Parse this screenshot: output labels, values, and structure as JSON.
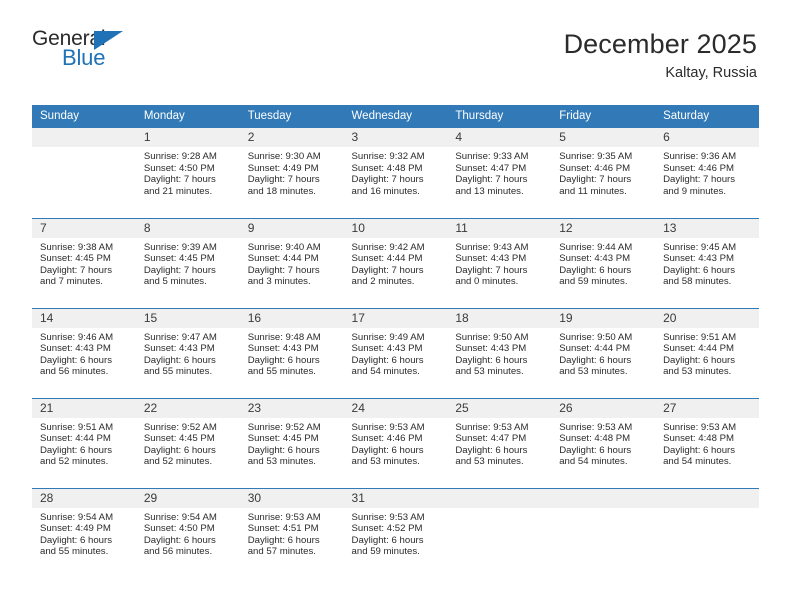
{
  "brand": {
    "name_part1": "General",
    "name_part2": "Blue",
    "accent_color": "#1f72b5",
    "triangle_icon": "triangle-icon"
  },
  "header": {
    "title": "December 2025",
    "subtitle": "Kaltay, Russia"
  },
  "theme": {
    "header_row_bg": "#3179b7",
    "header_row_text": "#ffffff",
    "daynum_bg": "#f0f0f0",
    "body_text": "#2b2b2b",
    "grid_line": "#3179b7"
  },
  "columns": [
    "Sunday",
    "Monday",
    "Tuesday",
    "Wednesday",
    "Thursday",
    "Friday",
    "Saturday"
  ],
  "weeks": [
    [
      {
        "day": "",
        "blank": true,
        "sunrise": "",
        "sunset": "",
        "daylight_line1": "",
        "daylight_line2": ""
      },
      {
        "day": "1",
        "sunrise": "Sunrise: 9:28 AM",
        "sunset": "Sunset: 4:50 PM",
        "daylight_line1": "Daylight: 7 hours",
        "daylight_line2": "and 21 minutes."
      },
      {
        "day": "2",
        "sunrise": "Sunrise: 9:30 AM",
        "sunset": "Sunset: 4:49 PM",
        "daylight_line1": "Daylight: 7 hours",
        "daylight_line2": "and 18 minutes."
      },
      {
        "day": "3",
        "sunrise": "Sunrise: 9:32 AM",
        "sunset": "Sunset: 4:48 PM",
        "daylight_line1": "Daylight: 7 hours",
        "daylight_line2": "and 16 minutes."
      },
      {
        "day": "4",
        "sunrise": "Sunrise: 9:33 AM",
        "sunset": "Sunset: 4:47 PM",
        "daylight_line1": "Daylight: 7 hours",
        "daylight_line2": "and 13 minutes."
      },
      {
        "day": "5",
        "sunrise": "Sunrise: 9:35 AM",
        "sunset": "Sunset: 4:46 PM",
        "daylight_line1": "Daylight: 7 hours",
        "daylight_line2": "and 11 minutes."
      },
      {
        "day": "6",
        "sunrise": "Sunrise: 9:36 AM",
        "sunset": "Sunset: 4:46 PM",
        "daylight_line1": "Daylight: 7 hours",
        "daylight_line2": "and 9 minutes."
      }
    ],
    [
      {
        "day": "7",
        "sunrise": "Sunrise: 9:38 AM",
        "sunset": "Sunset: 4:45 PM",
        "daylight_line1": "Daylight: 7 hours",
        "daylight_line2": "and 7 minutes."
      },
      {
        "day": "8",
        "sunrise": "Sunrise: 9:39 AM",
        "sunset": "Sunset: 4:45 PM",
        "daylight_line1": "Daylight: 7 hours",
        "daylight_line2": "and 5 minutes."
      },
      {
        "day": "9",
        "sunrise": "Sunrise: 9:40 AM",
        "sunset": "Sunset: 4:44 PM",
        "daylight_line1": "Daylight: 7 hours",
        "daylight_line2": "and 3 minutes."
      },
      {
        "day": "10",
        "sunrise": "Sunrise: 9:42 AM",
        "sunset": "Sunset: 4:44 PM",
        "daylight_line1": "Daylight: 7 hours",
        "daylight_line2": "and 2 minutes."
      },
      {
        "day": "11",
        "sunrise": "Sunrise: 9:43 AM",
        "sunset": "Sunset: 4:43 PM",
        "daylight_line1": "Daylight: 7 hours",
        "daylight_line2": "and 0 minutes."
      },
      {
        "day": "12",
        "sunrise": "Sunrise: 9:44 AM",
        "sunset": "Sunset: 4:43 PM",
        "daylight_line1": "Daylight: 6 hours",
        "daylight_line2": "and 59 minutes."
      },
      {
        "day": "13",
        "sunrise": "Sunrise: 9:45 AM",
        "sunset": "Sunset: 4:43 PM",
        "daylight_line1": "Daylight: 6 hours",
        "daylight_line2": "and 58 minutes."
      }
    ],
    [
      {
        "day": "14",
        "sunrise": "Sunrise: 9:46 AM",
        "sunset": "Sunset: 4:43 PM",
        "daylight_line1": "Daylight: 6 hours",
        "daylight_line2": "and 56 minutes."
      },
      {
        "day": "15",
        "sunrise": "Sunrise: 9:47 AM",
        "sunset": "Sunset: 4:43 PM",
        "daylight_line1": "Daylight: 6 hours",
        "daylight_line2": "and 55 minutes."
      },
      {
        "day": "16",
        "sunrise": "Sunrise: 9:48 AM",
        "sunset": "Sunset: 4:43 PM",
        "daylight_line1": "Daylight: 6 hours",
        "daylight_line2": "and 55 minutes."
      },
      {
        "day": "17",
        "sunrise": "Sunrise: 9:49 AM",
        "sunset": "Sunset: 4:43 PM",
        "daylight_line1": "Daylight: 6 hours",
        "daylight_line2": "and 54 minutes."
      },
      {
        "day": "18",
        "sunrise": "Sunrise: 9:50 AM",
        "sunset": "Sunset: 4:43 PM",
        "daylight_line1": "Daylight: 6 hours",
        "daylight_line2": "and 53 minutes."
      },
      {
        "day": "19",
        "sunrise": "Sunrise: 9:50 AM",
        "sunset": "Sunset: 4:44 PM",
        "daylight_line1": "Daylight: 6 hours",
        "daylight_line2": "and 53 minutes."
      },
      {
        "day": "20",
        "sunrise": "Sunrise: 9:51 AM",
        "sunset": "Sunset: 4:44 PM",
        "daylight_line1": "Daylight: 6 hours",
        "daylight_line2": "and 53 minutes."
      }
    ],
    [
      {
        "day": "21",
        "sunrise": "Sunrise: 9:51 AM",
        "sunset": "Sunset: 4:44 PM",
        "daylight_line1": "Daylight: 6 hours",
        "daylight_line2": "and 52 minutes."
      },
      {
        "day": "22",
        "sunrise": "Sunrise: 9:52 AM",
        "sunset": "Sunset: 4:45 PM",
        "daylight_line1": "Daylight: 6 hours",
        "daylight_line2": "and 52 minutes."
      },
      {
        "day": "23",
        "sunrise": "Sunrise: 9:52 AM",
        "sunset": "Sunset: 4:45 PM",
        "daylight_line1": "Daylight: 6 hours",
        "daylight_line2": "and 53 minutes."
      },
      {
        "day": "24",
        "sunrise": "Sunrise: 9:53 AM",
        "sunset": "Sunset: 4:46 PM",
        "daylight_line1": "Daylight: 6 hours",
        "daylight_line2": "and 53 minutes."
      },
      {
        "day": "25",
        "sunrise": "Sunrise: 9:53 AM",
        "sunset": "Sunset: 4:47 PM",
        "daylight_line1": "Daylight: 6 hours",
        "daylight_line2": "and 53 minutes."
      },
      {
        "day": "26",
        "sunrise": "Sunrise: 9:53 AM",
        "sunset": "Sunset: 4:48 PM",
        "daylight_line1": "Daylight: 6 hours",
        "daylight_line2": "and 54 minutes."
      },
      {
        "day": "27",
        "sunrise": "Sunrise: 9:53 AM",
        "sunset": "Sunset: 4:48 PM",
        "daylight_line1": "Daylight: 6 hours",
        "daylight_line2": "and 54 minutes."
      }
    ],
    [
      {
        "day": "28",
        "sunrise": "Sunrise: 9:54 AM",
        "sunset": "Sunset: 4:49 PM",
        "daylight_line1": "Daylight: 6 hours",
        "daylight_line2": "and 55 minutes."
      },
      {
        "day": "29",
        "sunrise": "Sunrise: 9:54 AM",
        "sunset": "Sunset: 4:50 PM",
        "daylight_line1": "Daylight: 6 hours",
        "daylight_line2": "and 56 minutes."
      },
      {
        "day": "30",
        "sunrise": "Sunrise: 9:53 AM",
        "sunset": "Sunset: 4:51 PM",
        "daylight_line1": "Daylight: 6 hours",
        "daylight_line2": "and 57 minutes."
      },
      {
        "day": "31",
        "sunrise": "Sunrise: 9:53 AM",
        "sunset": "Sunset: 4:52 PM",
        "daylight_line1": "Daylight: 6 hours",
        "daylight_line2": "and 59 minutes."
      },
      {
        "day": "",
        "blank": true,
        "sunrise": "",
        "sunset": "",
        "daylight_line1": "",
        "daylight_line2": ""
      },
      {
        "day": "",
        "blank": true,
        "sunrise": "",
        "sunset": "",
        "daylight_line1": "",
        "daylight_line2": ""
      },
      {
        "day": "",
        "blank": true,
        "sunrise": "",
        "sunset": "",
        "daylight_line1": "",
        "daylight_line2": ""
      }
    ]
  ]
}
